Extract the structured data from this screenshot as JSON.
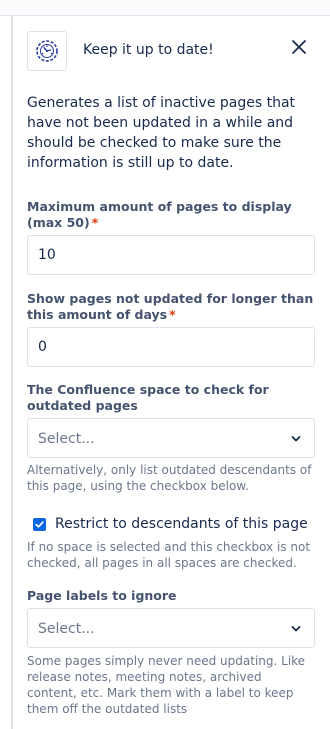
{
  "panel": {
    "title": "Keep it up to date!",
    "description": "Generates a list of inactive pages that have not been updated in a while and should be checked to make sure the information is still up to date.",
    "icons": {
      "app": "clock-badge-icon",
      "close": "close-icon",
      "dropdown": "chevron-down-icon",
      "check": "checkmark-icon"
    }
  },
  "fields": {
    "max_pages": {
      "label": "Maximum amount of pages to display (max 50)",
      "required_marker": "*",
      "value": "10"
    },
    "days": {
      "label": "Show pages not updated for longer than this amount of days",
      "required_marker": "*",
      "value": "0"
    },
    "space": {
      "label": "The Confluence space to check for outdated pages",
      "placeholder": "Select...",
      "help": "Alternatively, only list outdated descendants of this page, using the checkbox below."
    },
    "restrict": {
      "label": "Restrict to descendants of this page",
      "checked": true,
      "help": "If no space is selected and this checkbox is not checked, all pages in all spaces are checked."
    },
    "labels": {
      "label": "Page labels to ignore",
      "placeholder": "Select...",
      "help": "Some pages simply never need updating. Like release notes, meeting notes, archived content, etc. Mark them with a label to keep them off the outdated lists"
    }
  },
  "colors": {
    "accent": "#0c66e4",
    "required": "#de350b",
    "text": "#172b4d",
    "muted": "#6b778c",
    "border": "#dfe1e6"
  }
}
